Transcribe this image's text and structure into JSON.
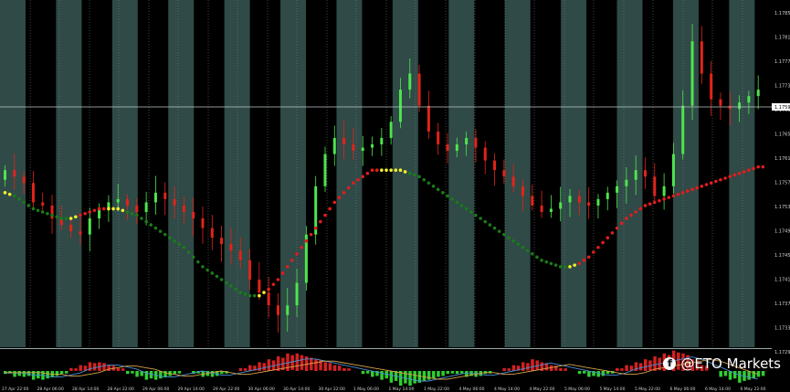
{
  "colors": {
    "background": "#000000",
    "band": "#2f4a47",
    "bull": "#4ee44e",
    "bear": "#e2231a",
    "ma_rising": "#e01d1d",
    "ma_falling": "#1a7a1a",
    "ma_flat": "#f2ef2e",
    "grid": "#7a8c8a",
    "hist_pos": "#d42020",
    "hist_neg": "#2fcf2f"
  },
  "watermark": {
    "icon": "facebook-icon",
    "text": "@ETO Markets"
  },
  "chart_data": {
    "type": "candlestick",
    "price_axis": [
      "1.17850",
      "1.17810",
      "1.17770",
      "1.17730",
      "1.17690",
      "1.17650",
      "1.17610",
      "1.17570",
      "1.17530",
      "1.17490",
      "1.17450",
      "1.17410",
      "1.17370",
      "1.17330",
      "1.17290"
    ],
    "current_price": "1.17590",
    "time_axis": [
      "27 Apr 22:00",
      "28 Apr 06:00",
      "28 Apr 14:00",
      "28 Apr 22:00",
      "29 Apr 06:00",
      "29 Apr 14:00",
      "29 Apr 22:00",
      "30 Apr 06:00",
      "30 Apr 14:00",
      "30 Apr 22:00",
      "1 May 06:00",
      "1 May 14:00",
      "1 May 22:00",
      "4 May 06:00",
      "4 May 14:00",
      "4 May 22:00",
      "5 May 06:00",
      "5 May 14:00",
      "5 May 22:00",
      "6 May 06:00",
      "6 May 14:00",
      "6 May 22:00"
    ],
    "closes": [
      1.174,
      1.1738,
      1.1736,
      1.173,
      1.1729,
      1.1725,
      1.1723,
      1.1721,
      1.172,
      1.1725,
      1.1728,
      1.173,
      1.1731,
      1.1729,
      1.1727,
      1.173,
      1.1733,
      1.1731,
      1.1729,
      1.1727,
      1.1725,
      1.1722,
      1.1719,
      1.1717,
      1.1715,
      1.1712,
      1.1706,
      1.1702,
      1.1698,
      1.1695,
      1.1698,
      1.1705,
      1.172,
      1.1735,
      1.1745,
      1.175,
      1.1748,
      1.1746,
      1.1747,
      1.1748,
      1.175,
      1.1755,
      1.1765,
      1.177,
      1.176,
      1.1752,
      1.1748,
      1.1746,
      1.1748,
      1.175,
      1.1747,
      1.1743,
      1.174,
      1.1738,
      1.1735,
      1.1732,
      1.1729,
      1.1727,
      1.1728,
      1.173,
      1.1732,
      1.173,
      1.1729,
      1.1731,
      1.1733,
      1.1735,
      1.1737,
      1.174,
      1.1738,
      1.1732,
      1.1735,
      1.1745,
      1.176,
      1.178,
      1.177,
      1.1762,
      1.176,
      1.1759,
      1.1761,
      1.1763,
      1.1765
    ],
    "moving_average": [
      1.1733,
      1.1732,
      1.173,
      1.1728,
      1.1727,
      1.1726,
      1.1725,
      1.1725,
      1.1726,
      1.1727,
      1.1728,
      1.1728,
      1.1728,
      1.1727,
      1.1726,
      1.1724,
      1.1722,
      1.172,
      1.1718,
      1.1716,
      1.1713,
      1.171,
      1.1708,
      1.1706,
      1.1704,
      1.1702,
      1.1701,
      1.1701,
      1.1703,
      1.1706,
      1.171,
      1.1714,
      1.1718,
      1.1722,
      1.1726,
      1.173,
      1.1733,
      1.1736,
      1.1738,
      1.174,
      1.174,
      1.174,
      1.174,
      1.1739,
      1.1738,
      1.1736,
      1.1734,
      1.1732,
      1.173,
      1.1728,
      1.1726,
      1.1724,
      1.1722,
      1.172,
      1.1718,
      1.1716,
      1.1714,
      1.1712,
      1.1711,
      1.171,
      1.171,
      1.1711,
      1.1713,
      1.1716,
      1.1719,
      1.1722,
      1.1725,
      1.1727,
      1.1729,
      1.173,
      1.1731,
      1.1732,
      1.1733,
      1.1734,
      1.1735,
      1.1736,
      1.1737,
      1.1738,
      1.1739,
      1.174,
      1.1741
    ],
    "histogram": [
      -1,
      -2,
      -2,
      -3,
      -3,
      -2,
      -1,
      1,
      2,
      3,
      3,
      2,
      1,
      -1,
      -2,
      -3,
      -3,
      -2,
      -1,
      0,
      -1,
      -2,
      -2,
      -1,
      0,
      1,
      2,
      3,
      4,
      5,
      6,
      6,
      5,
      4,
      3,
      2,
      1,
      0,
      -1,
      -2,
      -3,
      -4,
      -5,
      -5,
      -4,
      -3,
      -2,
      -1,
      -1,
      -2,
      -2,
      -1,
      0,
      1,
      2,
      3,
      4,
      3,
      2,
      1,
      0,
      -1,
      -2,
      -2,
      -1,
      1,
      2,
      3,
      4,
      5,
      6,
      7,
      6,
      4,
      2,
      0,
      -2,
      -3,
      -4,
      -3,
      -2
    ],
    "grid": true,
    "vertical_bands": true
  }
}
